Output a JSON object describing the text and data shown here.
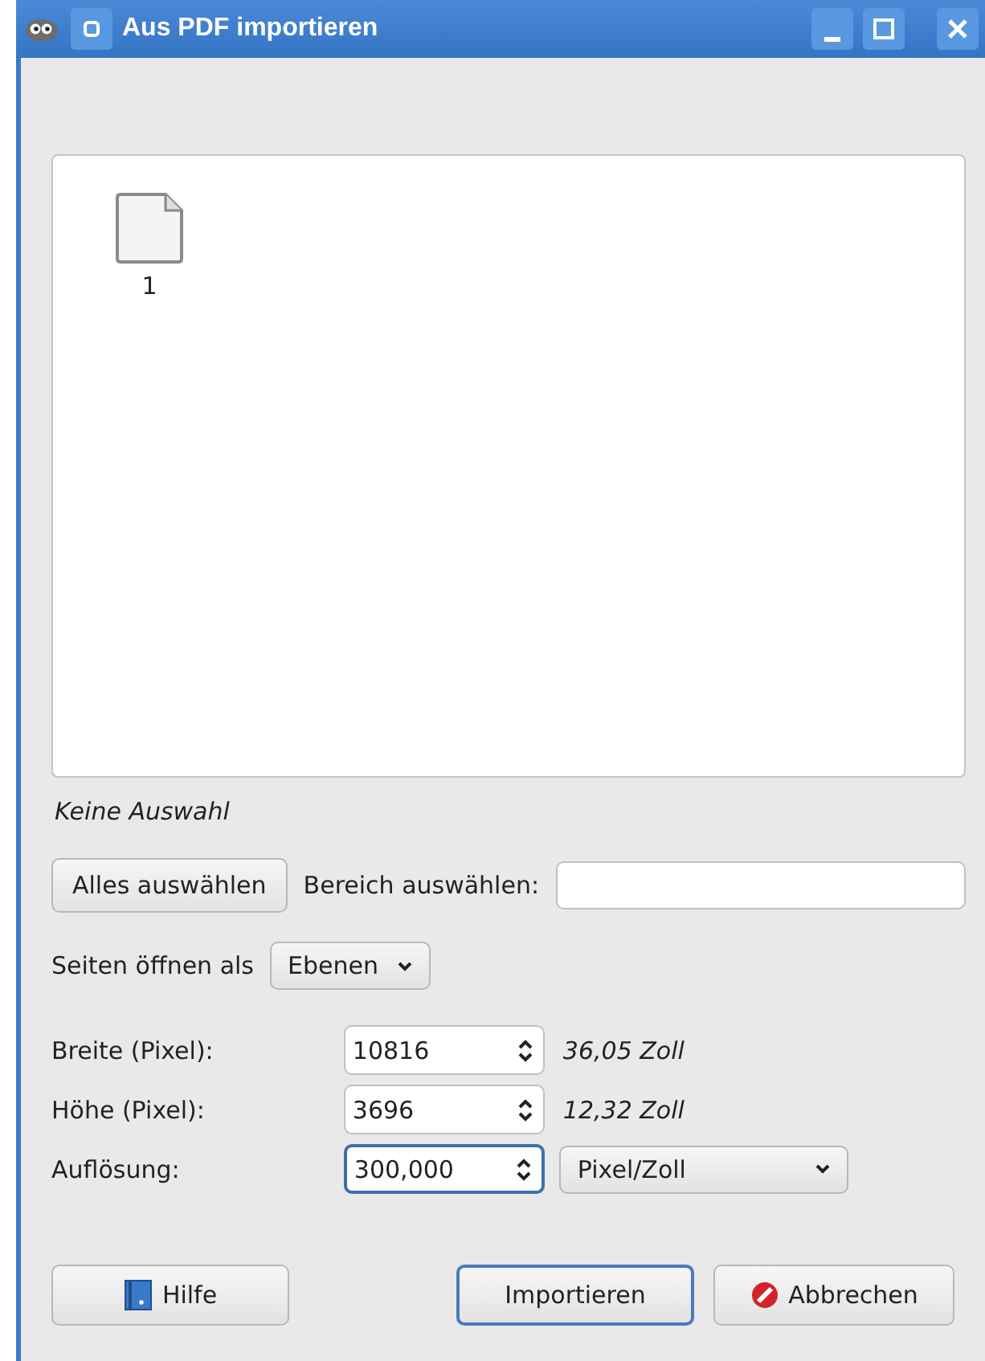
{
  "window": {
    "title": "Aus PDF importieren"
  },
  "pages": [
    {
      "label": "1",
      "selected": false
    }
  ],
  "selection_status": "Keine Auswahl",
  "select_all_button": "Alles auswählen",
  "range": {
    "label": "Bereich auswählen:"
  },
  "open_as": {
    "label": "Seiten öffnen als",
    "value": "Ebenen"
  },
  "size_rows": [
    {
      "kind": "spin",
      "label": "Breite (Pixel):",
      "value": "10816",
      "focused": false,
      "unit_text": "36,05 Zoll"
    },
    {
      "kind": "spin",
      "label": "Höhe (Pixel):",
      "value": "3696",
      "focused": false,
      "unit_text": "12,32 Zoll"
    },
    {
      "kind": "spin_unit",
      "label": "Auflösung:",
      "value": "300,000",
      "focused": true,
      "unit_select": "Pixel/Zoll"
    }
  ],
  "buttons": [
    {
      "kind": "help",
      "label": "Hilfe",
      "default": false
    },
    {
      "kind": "import",
      "label": "Importieren",
      "default": true
    },
    {
      "kind": "cancel",
      "label": "Abbrechen",
      "default": false
    }
  ]
}
